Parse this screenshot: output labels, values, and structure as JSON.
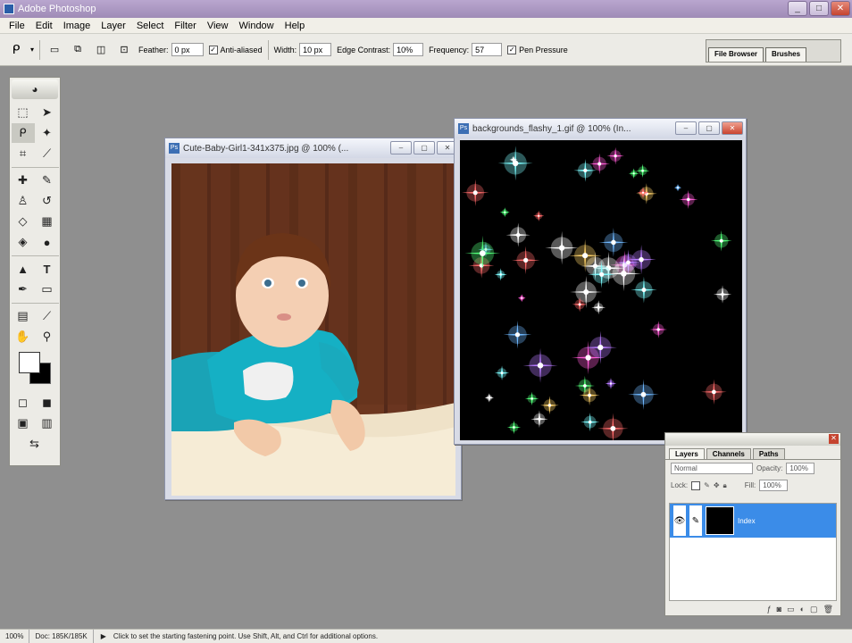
{
  "app": {
    "title": "Adobe Photoshop"
  },
  "menu": [
    "File",
    "Edit",
    "Image",
    "Layer",
    "Select",
    "Filter",
    "View",
    "Window",
    "Help"
  ],
  "options": {
    "feather_label": "Feather:",
    "feather_value": "0 px",
    "antialiased_label": "Anti-aliased",
    "width_label": "Width:",
    "width_value": "10 px",
    "edge_contrast_label": "Edge Contrast:",
    "edge_contrast_value": "10%",
    "frequency_label": "Frequency:",
    "frequency_value": "57",
    "pen_pressure_label": "Pen Pressure"
  },
  "palette_well": [
    "File Browser",
    "Brushes"
  ],
  "documents": {
    "baby": {
      "title": "Cute-Baby-Girl1-341x375.jpg @ 100% (..."
    },
    "sparkle": {
      "title": "backgrounds_flashy_1.gif @ 100% (In..."
    }
  },
  "layers_panel": {
    "tabs": [
      "Layers",
      "Channels",
      "Paths"
    ],
    "blend_mode": "Normal",
    "opacity_label": "Opacity:",
    "opacity_value": "100%",
    "lock_label": "Lock:",
    "fill_label": "Fill:",
    "fill_value": "100%",
    "layer_name": "Index"
  },
  "status": {
    "zoom": "100%",
    "doc": "Doc: 185K/185K",
    "hint": "Click to set the starting fastening point.  Use Shift, Alt, and Ctrl for additional options."
  }
}
